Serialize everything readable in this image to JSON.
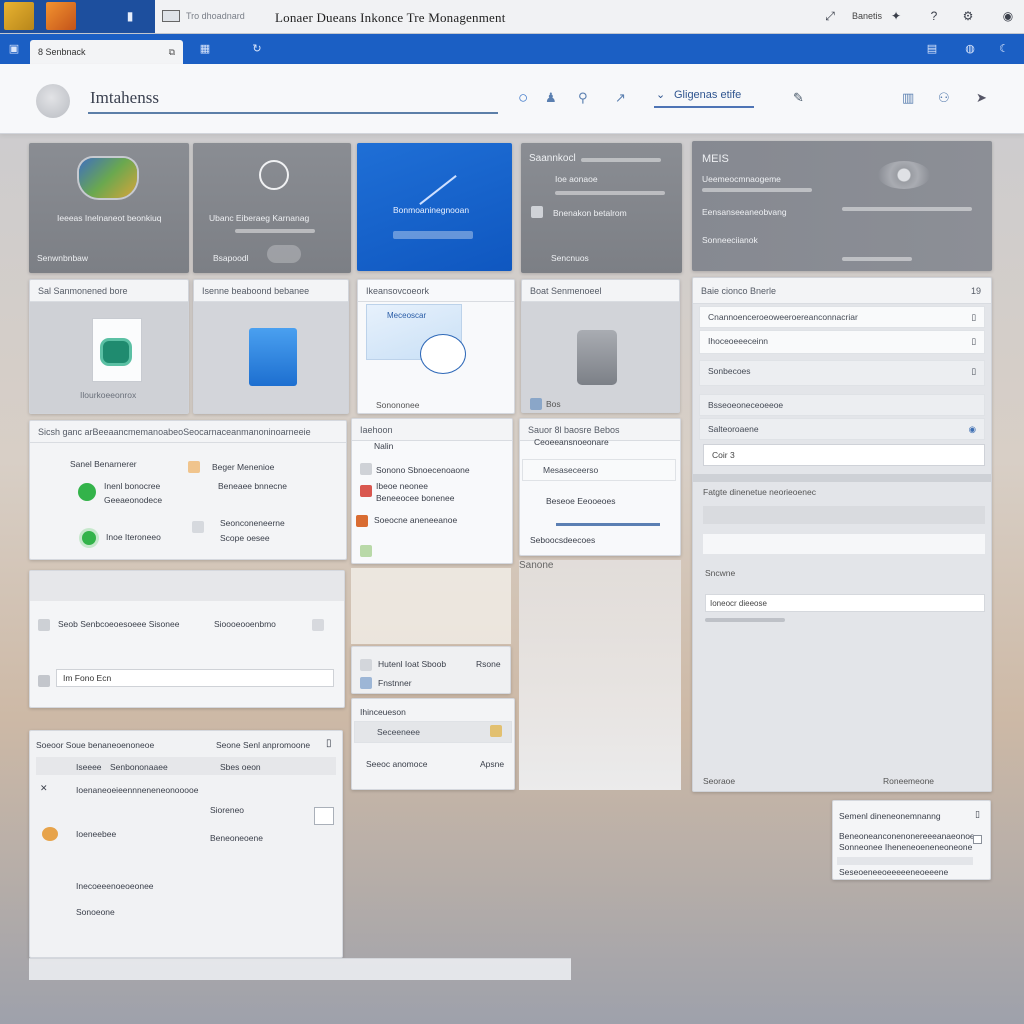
{
  "titlebar": {
    "address": "Tro dhoadnard",
    "title": "Lonaer Dueans Inkonce Tre Monagenment",
    "right_label": "Banetis"
  },
  "menubar": {
    "tab_label": "8 Senbnack"
  },
  "search": {
    "value": "Imtahenss",
    "selector_label": "Gligenas etife"
  },
  "row1": {
    "t1": {
      "label": "Ieeeas Inelnaneot beonkiuq",
      "footer": "Senwnbnbaw"
    },
    "t2": {
      "label": "Ubanc Eiberaeg Karnanag",
      "footer": "Bsapoodl"
    },
    "t3": {
      "label": "Bonmoaninegnooan"
    },
    "t4": {
      "title": "Saannkocl",
      "line1": "Ioe aonaoe",
      "line2": "Bnenakon betalrom",
      "footer": "Sencnuos"
    },
    "t5": {
      "title": "MEIS",
      "line1": "Ueemeocmnaogeme",
      "line2": "Eensanseeaneobvang",
      "line3": "Sonneeciianok"
    }
  },
  "row2": {
    "t1": {
      "header": "Sal Sanmonened bore",
      "footer": "Ilourkoeeonrox"
    },
    "t2": {
      "header": "Isenne beaboond bebanee"
    },
    "t3": {
      "header": "Ikeansovcoeork",
      "card": "Meceoscar",
      "footer": "Sonononee"
    },
    "t4": {
      "header": "Boat Senmenoeel",
      "footer": "Bos"
    }
  },
  "right_panel": {
    "header": "Baie cionco Bnerle",
    "header_count": "19",
    "rows": [
      "Cnannoenceroeoweeroereanconnacriar",
      "Ihoceoeeeceinn",
      "Sonbecoes",
      "Bsseoeoneceoeeoe",
      "Salteoroaene"
    ],
    "input_value": "Coir 3",
    "section2_header": "Fatgte dinenetue neorieoenec",
    "section2_rows": [
      "Sncwne",
      "Ioneocr dieeose"
    ],
    "footer_left": "Seoraoe",
    "footer_right": "Roneemeone"
  },
  "row3": {
    "panel1": {
      "header": "Sicsh ganc arBeeaancmemanoabeoSeocarnaceanmanoninoarneeie",
      "section": "Sanel Benarnerer",
      "items": [
        "Inenl bonocree",
        "Geeaeonodece",
        "Inoe Iteroneeo"
      ],
      "right_items": [
        "Beger Menenioe",
        "Beneaee bnnecne",
        "Seonconeneerne",
        "Scope oesee"
      ]
    },
    "list1": {
      "header": "Iaehoon",
      "sub": "Nalin",
      "items": [
        "Sonono Sbnoecenoaone",
        "Ibeoe neonee",
        "Beneeocee bonenee",
        "Soeocne aneneeanoe"
      ]
    },
    "list2": {
      "header": "Sauor 8l baosre Bebos",
      "sub": "Ceoeeansnoeonare",
      "items": [
        "Mesaseceerso",
        "Beseoe Eeooeoes"
      ],
      "footer": "Seboocsdeecoes"
    }
  },
  "row4": {
    "panel": {
      "row_label": "Seob Senbcoeoesoeee Sisonee",
      "row_value": "Sioooeooenbmo",
      "input_value": "Im Fono Ecn"
    },
    "mid1": {
      "label": "Hutenl Ioat Sboob",
      "right": "Rsone",
      "sub": "Fnstnner"
    },
    "mid2": {
      "header": "Ihinceueson",
      "sub": "Seceeneee",
      "footer": "Seeoc anomoce",
      "footer_right": "Apsne"
    },
    "col": {
      "footer": "Sanone"
    }
  },
  "row5": {
    "header_left": "Soeoor Soue benaneoenoneoe",
    "header_right": "Seone Senl anpromoone",
    "tab1": "Iseeee",
    "tab2": "Senbononaaee",
    "tab3": "Sbes oeon",
    "row_label": "Ioenaneoeieennneneneonooooe",
    "lines": [
      "Ioeneebee",
      "Sioreneo",
      "Beneoneoene",
      "Inecoeeenoeoeonee",
      "Sonoeone"
    ]
  },
  "popup": {
    "header": "Semenl dineneonemnanng",
    "lines": [
      "Beneoneanconenonereeeanaeonoe",
      "Sonneonee Iheneneoeneneoneone",
      "Seseoeneeoeeeeeneoeeene"
    ]
  },
  "colors": {
    "accent": "#1b5fc4",
    "tile_blue": "#1565d0",
    "tile_grey": "#838690",
    "green": "#33b34a"
  }
}
